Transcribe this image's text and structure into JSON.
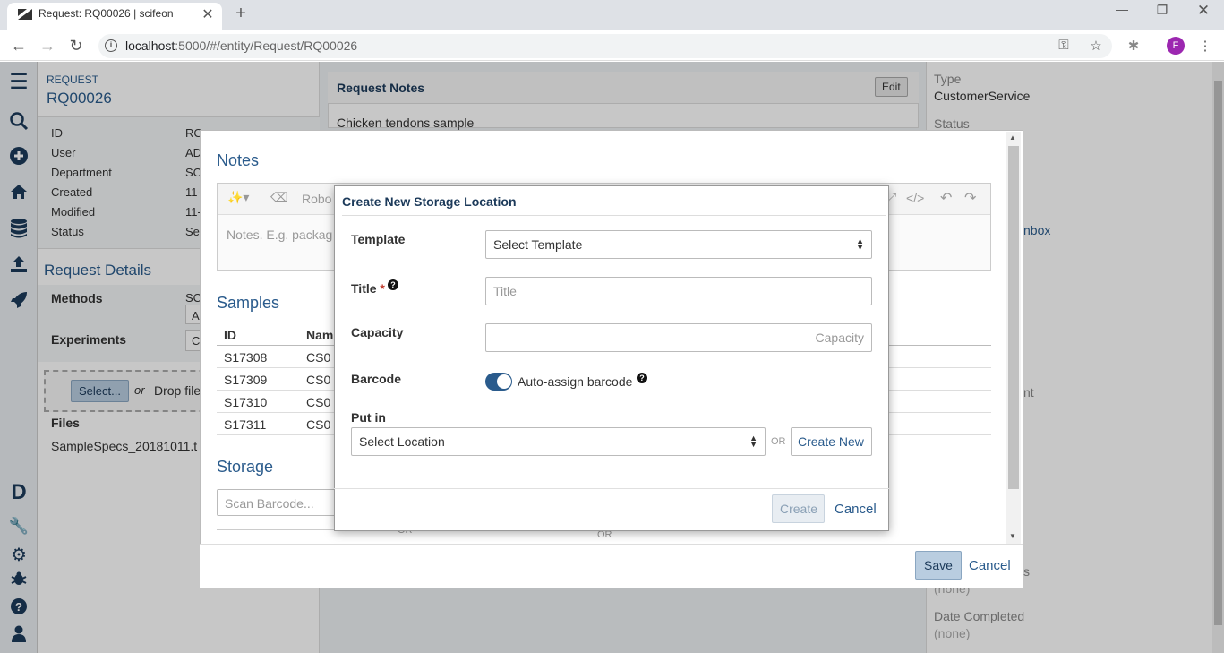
{
  "browser": {
    "tab_title": "Request: RQ00026 | scifeon",
    "url_host": "localhost",
    "url_path": ":5000/#/entity/Request/RQ00026",
    "profile_initial": "F"
  },
  "sidebar_brand": "D",
  "entity": {
    "type_label": "REQUEST",
    "id": "RQ00026",
    "fields": [
      {
        "label": "ID",
        "value": "RC"
      },
      {
        "label": "User",
        "value": "AD"
      },
      {
        "label": "Department",
        "value": "SC"
      },
      {
        "label": "Created",
        "value": "11-"
      },
      {
        "label": "Modified",
        "value": "11-"
      },
      {
        "label": "Status",
        "value": "Se"
      }
    ],
    "details_title": "Request Details",
    "methods_label": "Methods",
    "methods_value": "SC",
    "methods_input": "A",
    "experiments_label": "Experiments",
    "experiments_input": "C",
    "select_button": "Select...",
    "or_text": "or",
    "drop_text": "Drop file",
    "files_label": "Files",
    "file_name": "SampleSpecs_20181011.t"
  },
  "request_notes": {
    "title": "Request Notes",
    "edit_button": "Edit",
    "text": "Chicken tendons sample"
  },
  "right_panel": {
    "type_label": "Type",
    "type_value": "CustomerService",
    "status_label": "Status",
    "partial_1": "nbox",
    "partial_2": "nt",
    "partial_3": "s",
    "none_1": "(none)",
    "date_completed_label": "Date Completed",
    "none_2": "(none)"
  },
  "notes_modal": {
    "title": "Notes",
    "editor_font": "Robo",
    "editor_placeholder": "Notes. E.g. packag",
    "samples_title": "Samples",
    "samples_columns": [
      "ID",
      "Nam"
    ],
    "samples_rows": [
      {
        "id": "S17308",
        "name": "CS0"
      },
      {
        "id": "S17309",
        "name": "CS0"
      },
      {
        "id": "S17310",
        "name": "CS0"
      },
      {
        "id": "S17311",
        "name": "CS0"
      }
    ],
    "storage_title": "Storage",
    "scan_placeholder": "Scan Barcode...",
    "or_1": "OR",
    "or_2": "OR",
    "save_button": "Save",
    "cancel_button": "Cancel"
  },
  "storage_dialog": {
    "title": "Create New Storage Location",
    "template_label": "Template",
    "template_value": "Select Template",
    "title_label": "Title",
    "required_mark": "*",
    "title_placeholder": "Title",
    "capacity_label": "Capacity",
    "capacity_placeholder": "Capacity",
    "barcode_label": "Barcode",
    "barcode_toggle_text": "Auto-assign barcode",
    "barcode_auto_assign": true,
    "put_in_label": "Put in",
    "location_value": "Select Location",
    "or_text": "OR",
    "create_new_button": "Create New",
    "create_button": "Create",
    "cancel_button": "Cancel"
  }
}
